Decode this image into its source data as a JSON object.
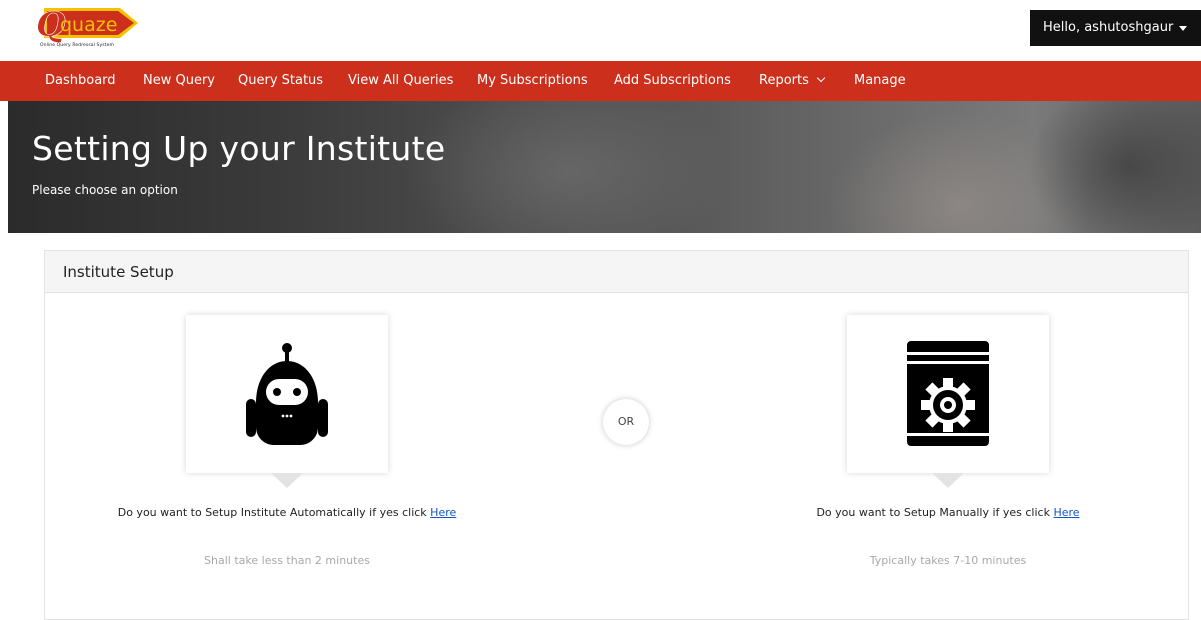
{
  "brand": {
    "logo_letter": "Q",
    "logo_text": "quaze",
    "tagline": "Online Query Redressal System",
    "accent_color": "#cc2f1c",
    "logo_yellow": "#f2c200"
  },
  "user_menu": {
    "greeting": "Hello, ashutoshgaur"
  },
  "nav": {
    "items": [
      {
        "label": "Dashboard"
      },
      {
        "label": "New Query"
      },
      {
        "label": "Query Status"
      },
      {
        "label": "View All Queries"
      },
      {
        "label": "My Subscriptions"
      },
      {
        "label": "Add Subscriptions"
      },
      {
        "label": "Reports",
        "has_dropdown": true
      },
      {
        "label": "Manage"
      }
    ]
  },
  "hero": {
    "title": "Setting Up your Institute",
    "subtitle": "Please choose an option"
  },
  "card": {
    "title": "Institute Setup",
    "separator": "OR",
    "options": [
      {
        "icon": "robot-icon",
        "text_before": "Do you want to Setup Institute Automatically if yes click",
        "link": "Here",
        "note": "Shall take less than 2 minutes"
      },
      {
        "icon": "settings-book-icon",
        "text_before": "Do you want to Setup Manually if yes click",
        "link": "Here",
        "note": "Typically takes 7-10 minutes"
      }
    ]
  }
}
